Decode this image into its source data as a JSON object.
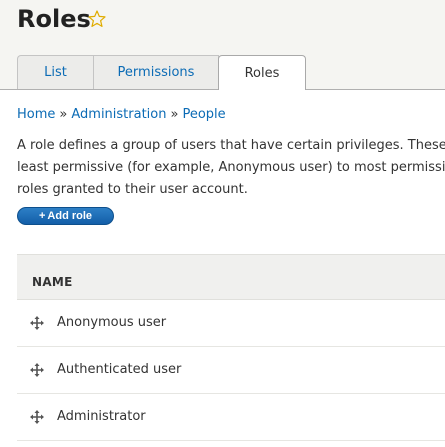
{
  "page": {
    "title": "Roles",
    "star_icon": "star-outline-icon",
    "star_color": "#e0ac00"
  },
  "tabs": [
    {
      "label": "List",
      "active": false
    },
    {
      "label": "Permissions",
      "active": false
    },
    {
      "label": "Roles",
      "active": true
    }
  ],
  "breadcrumb": {
    "items": [
      "Home",
      "Administration",
      "People"
    ],
    "separator": "»"
  },
  "description": {
    "lines": [
      "A role defines a group of users that have certain privileges. These p",
      "least permissive (for example, Anonymous user) to most permissive",
      "roles granted to their user account."
    ]
  },
  "add_role": {
    "plus": "+",
    "label": "Add role",
    "color": "#1b6db7"
  },
  "table": {
    "header_name": "NAME",
    "drag_icon": "drag-handle-icon",
    "rows": [
      {
        "name": "Anonymous user"
      },
      {
        "name": "Authenticated user"
      },
      {
        "name": "Administrator"
      }
    ]
  },
  "colors": {
    "link": "#0b6bb5",
    "header_bg": "#f5f5f2"
  }
}
